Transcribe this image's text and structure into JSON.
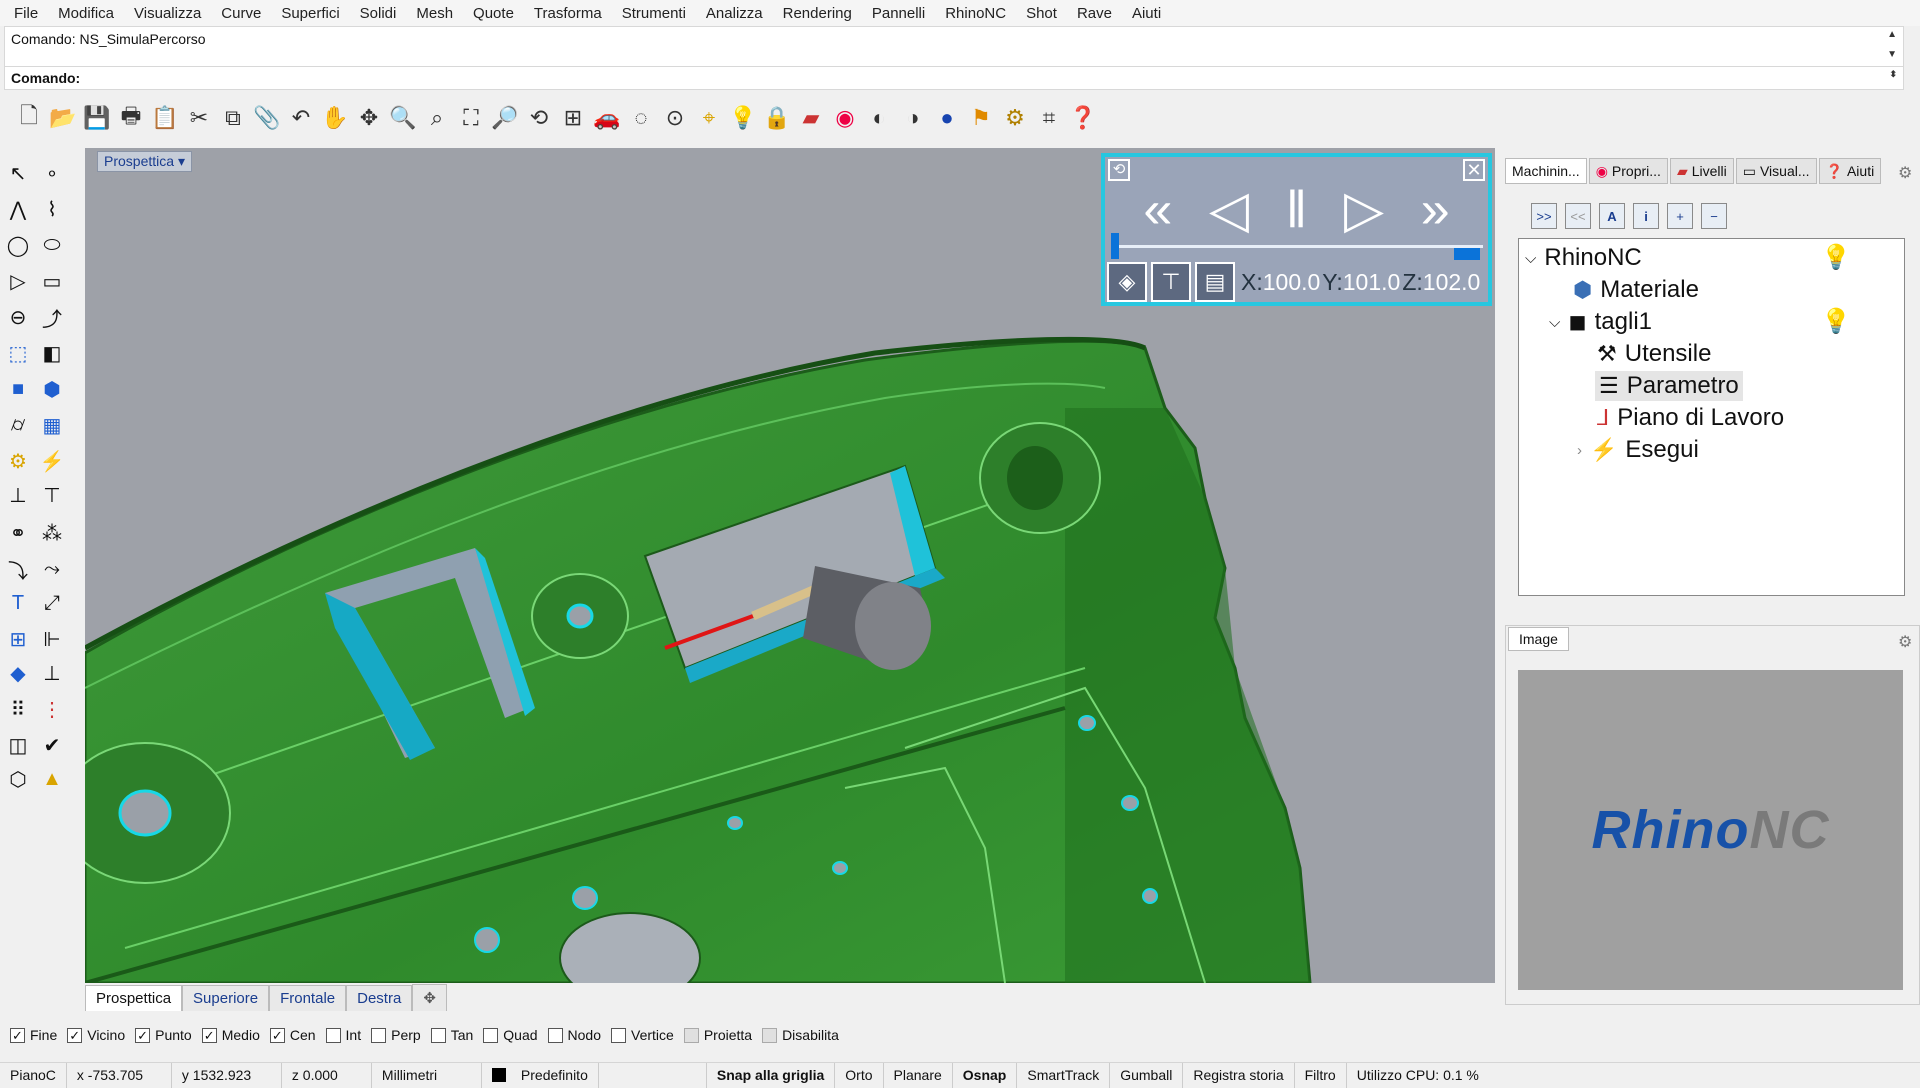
{
  "menu": [
    "File",
    "Modifica",
    "Visualizza",
    "Curve",
    "Superfici",
    "Solidi",
    "Mesh",
    "Quote",
    "Trasforma",
    "Strumenti",
    "Analizza",
    "Rendering",
    "Pannelli",
    "RhinoNC",
    "Shot",
    "Rave",
    "Aiuti"
  ],
  "command": {
    "history": "Comando: NS_SimulaPercorso",
    "prompt": "Comando:"
  },
  "toolbar_icons": [
    "new-file-icon",
    "open-folder-icon",
    "save-icon",
    "print-icon",
    "paste-icon",
    "cut-icon",
    "copy-icon",
    "clipboard-icon",
    "undo-icon",
    "pan-hand-icon",
    "move-icon",
    "zoom-icon",
    "zoom-window-icon",
    "zoom-extents-icon",
    "zoom-selected-icon",
    "rotate-view-icon",
    "four-views-icon",
    "car-icon",
    "hide-icon",
    "point-icon",
    "snap-icon",
    "lightbulb-icon",
    "lock-icon",
    "layer-icon",
    "color-wheel-icon",
    "shade-icon",
    "render-icon",
    "sphere-icon",
    "flag-icon",
    "gear-cluster-icon",
    "gumball-icon",
    "help-icon"
  ],
  "viewport": {
    "title": "Prospettica"
  },
  "simulation": {
    "x_label": "X:",
    "x": "100.0",
    "y_label": "Y:",
    "y": "101.0",
    "z_label": "Z:",
    "z": "102.0",
    "progress": 0.0
  },
  "viewport_tabs": [
    "Prospettica",
    "Superiore",
    "Frontale",
    "Destra"
  ],
  "osnap": [
    {
      "label": "Fine",
      "checked": true
    },
    {
      "label": "Vicino",
      "checked": true
    },
    {
      "label": "Punto",
      "checked": true
    },
    {
      "label": "Medio",
      "checked": true
    },
    {
      "label": "Cen",
      "checked": true
    },
    {
      "label": "Int",
      "checked": false
    },
    {
      "label": "Perp",
      "checked": false
    },
    {
      "label": "Tan",
      "checked": false
    },
    {
      "label": "Quad",
      "checked": false
    },
    {
      "label": "Nodo",
      "checked": false
    },
    {
      "label": "Vertice",
      "checked": false
    },
    {
      "label": "Proietta",
      "checked": false,
      "disabled": true
    },
    {
      "label": "Disabilita",
      "checked": false,
      "disabled": true
    }
  ],
  "status": {
    "plane": "PianoC",
    "x": "x -753.705",
    "y": "y 1532.923",
    "z": "z 0.000",
    "units": "Millimetri",
    "layer": "Predefinito",
    "snap": "Snap alla griglia",
    "ortho": "Orto",
    "planar": "Planare",
    "osnap": "Osnap",
    "smarttrack": "SmartTrack",
    "gumball": "Gumball",
    "history": "Registra storia",
    "filter": "Filtro",
    "cpu": "Utilizzo CPU: 0.1 %"
  },
  "right_tabs": [
    "Machinin...",
    "Propri...",
    "Livelli",
    "Visual...",
    "Aiuti"
  ],
  "panel_buttons": [
    ">>",
    "<<",
    "A",
    "i",
    "+",
    "−"
  ],
  "tree": {
    "root": "RhinoNC",
    "material": "Materiale",
    "op": "tagli1",
    "tool": "Utensile",
    "param": "Parametro",
    "plane": "Piano di Lavoro",
    "run": "Esegui"
  },
  "image_panel": {
    "tab": "Image",
    "logo_a": "Rhino",
    "logo_b": "NC"
  }
}
